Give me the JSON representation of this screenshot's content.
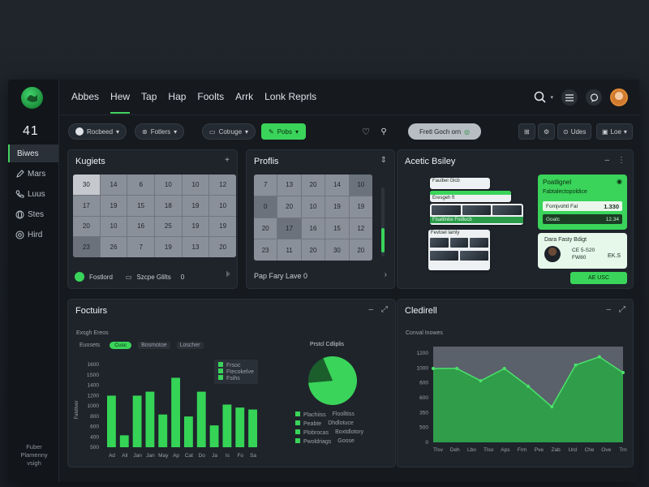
{
  "sidebar": {
    "counter": "41",
    "items": [
      {
        "label": "Biwes",
        "icon": "none"
      },
      {
        "label": "Mars",
        "icon": "pen-icon"
      },
      {
        "label": "Luus",
        "icon": "phone-icon"
      },
      {
        "label": "Stes",
        "icon": "globe-icon"
      },
      {
        "label": "Hird",
        "icon": "target-icon"
      }
    ],
    "footer": "Fuber Plamenny vsigh"
  },
  "nav": {
    "links": [
      "Abbes",
      "Hew",
      "Tap",
      "Hap",
      "Foolts",
      "Arrk",
      "Lonk Reprls"
    ],
    "active": "Hew"
  },
  "toolbar": {
    "user_pill": "Rocbeed",
    "filter_pill": "Fotlers",
    "change_pill": "Cotruge",
    "green_pill": "Pobs",
    "search_pill": "Fretl Goch orn",
    "btn_list": "Udes",
    "btn_view": "Loe"
  },
  "kugiets": {
    "title": "Kugiets",
    "grid": [
      [
        "30",
        "14",
        "6",
        "10",
        "10",
        "12"
      ],
      [
        "17",
        "19",
        "15",
        "18",
        "19",
        "10"
      ],
      [
        "20",
        "10",
        "16",
        "25",
        "19",
        "19"
      ],
      [
        "23",
        "26",
        "7",
        "19",
        "13",
        "20"
      ]
    ],
    "footer_a": "Fostlord",
    "footer_b": "Szcpe Glilts",
    "footer_c": "0"
  },
  "profils": {
    "title": "Proflis",
    "grid": [
      [
        "7",
        "13",
        "20",
        "14",
        "10"
      ],
      [
        "0",
        "20",
        "10",
        "19",
        "19"
      ],
      [
        "20",
        "17",
        "16",
        "15",
        "12"
      ],
      [
        "23",
        "11",
        "20",
        "30",
        "20"
      ]
    ],
    "footer": "Pap Fary Lave 0"
  },
  "acetic": {
    "title": "Acetic Bsiley",
    "feature_title": "Poatlignel",
    "feature_sub": "Fabtalectopoldice",
    "feature_row_label": "Fomjvohtl Fal",
    "feature_row_value": "1.330",
    "feature_row2_label": "Goalc",
    "feature_row2_value": "12.34",
    "profile_title": "Dara Fasty Bdigt",
    "profile_line1": "CE 5-S20",
    "profile_line2": "FW80",
    "profile_value": "EK.S",
    "add_button": "AE USC",
    "win_texts": [
      "Faulbel Glcb",
      "Eresgeh ft",
      "Fisaltinbe Fodlucb",
      "Fevtoel lamly",
      "Sowrlatrc"
    ]
  },
  "features": {
    "title": "Foctuirs",
    "subtitle": "Exsgh Ereos",
    "filters": [
      "Euosets",
      "Cusc",
      "Bosmotoe",
      "Loscher"
    ],
    "legend": [
      "Frsoc",
      "Ftecokelve",
      "Fsihs"
    ],
    "pie_title": "Prstcl Cdliplis",
    "pie_legend": [
      [
        "Plachiiss",
        "Floolltiss"
      ],
      [
        "Peabte",
        "Dhdlotuce"
      ],
      [
        "Plobrocas",
        "Boxtdlotory"
      ],
      [
        "Pwoldriags",
        "Goose"
      ]
    ]
  },
  "cledirell": {
    "title": "Cledirell",
    "subtitle": "Conval Inowes"
  },
  "chart_data": [
    {
      "type": "bar",
      "ylabel": "Falotiver",
      "yticks": [
        "1600",
        "1S00",
        "1400",
        "1200",
        "1000",
        "800",
        "600",
        "400",
        "500"
      ],
      "categories": [
        "Ad",
        "All",
        "Jan",
        "Jan",
        "May",
        "Ap",
        "Cat",
        "Do",
        "Ja",
        "Is",
        "Fo",
        "Sa"
      ],
      "series": [
        {
          "values": [
            520,
            0,
            520,
            560,
            0,
            700,
            0,
            560,
            0,
            430,
            400,
            380
          ]
        },
        {
          "values": [
            0,
            120,
            0,
            0,
            330,
            0,
            310,
            0,
            220,
            0,
            0,
            0
          ]
        }
      ],
      "ylim": [
        0,
        900
      ]
    },
    {
      "type": "pie",
      "values": [
        80,
        20
      ]
    },
    {
      "type": "area",
      "yticks": [
        "1200",
        "1000",
        "600",
        "600",
        "350",
        "500",
        "0"
      ],
      "xticks": [
        "Tlsv",
        "Deh",
        "Lbo",
        "Tlso",
        "Aps",
        "Frm",
        "Pve",
        "Zab",
        "Urd",
        "Che",
        "Ove",
        "Trn"
      ],
      "values": [
        1080,
        1080,
        900,
        1080,
        820,
        520,
        1130,
        1250,
        1020
      ],
      "ylim": [
        0,
        1400
      ]
    }
  ]
}
